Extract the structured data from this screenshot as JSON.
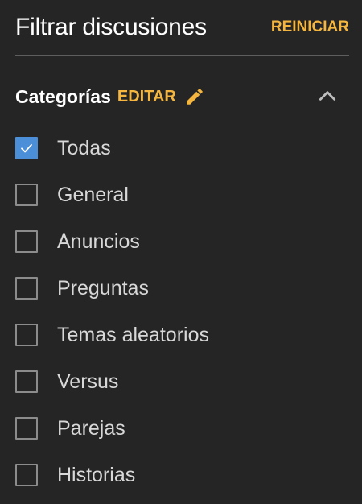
{
  "header": {
    "title": "Filtrar discusiones",
    "reset_label": "REINICIAR"
  },
  "categories": {
    "title": "Categorías",
    "edit_label": "EDITAR",
    "collapse_icon": "chevron-up-icon",
    "edit_icon": "pencil-icon",
    "items": [
      {
        "label": "Todas",
        "checked": true
      },
      {
        "label": "General",
        "checked": false
      },
      {
        "label": "Anuncios",
        "checked": false
      },
      {
        "label": "Preguntas",
        "checked": false
      },
      {
        "label": "Temas aleatorios",
        "checked": false
      },
      {
        "label": "Versus",
        "checked": false
      },
      {
        "label": "Parejas",
        "checked": false
      },
      {
        "label": "Historias",
        "checked": false
      }
    ]
  },
  "colors": {
    "background": "#252525",
    "accent": "#f4b63f",
    "checkbox_checked": "#4a8fd7",
    "checkbox_border": "#8c8c8c",
    "divider": "#5e5e5e"
  }
}
